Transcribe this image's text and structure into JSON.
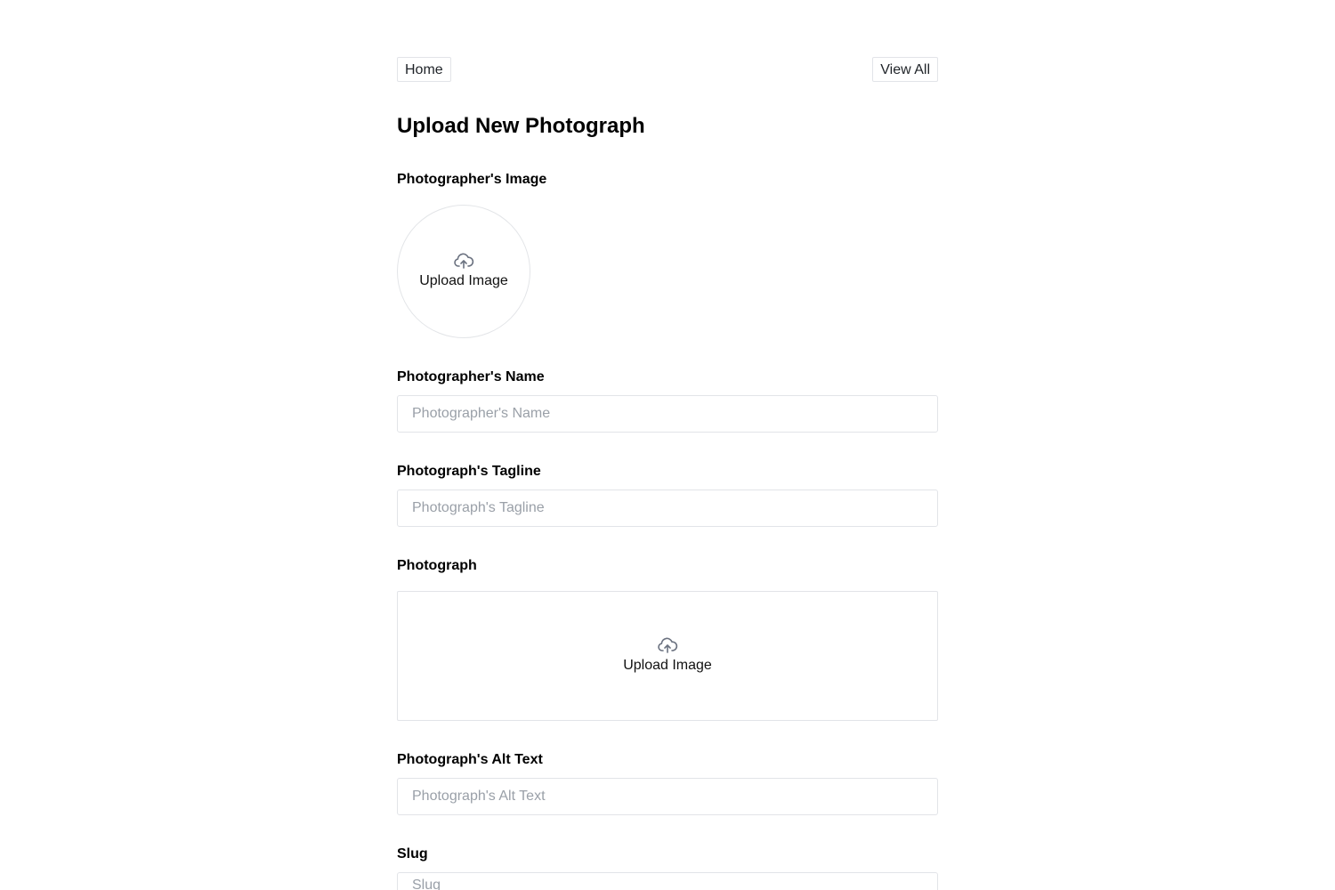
{
  "nav": {
    "home_label": "Home",
    "view_all_label": "View All"
  },
  "page": {
    "title": "Upload New Photograph"
  },
  "form": {
    "photographer_image": {
      "label": "Photographer's Image",
      "upload_text": "Upload Image",
      "icon": "cloud-upload-icon"
    },
    "photographer_name": {
      "label": "Photographer's Name",
      "placeholder": "Photographer's Name",
      "value": ""
    },
    "tagline": {
      "label": "Photograph's Tagline",
      "placeholder": "Photograph's Tagline",
      "value": ""
    },
    "photograph": {
      "label": "Photograph",
      "upload_text": "Upload Image",
      "icon": "cloud-upload-icon"
    },
    "alt_text": {
      "label": "Photograph's Alt Text",
      "placeholder": "Photograph's Alt Text",
      "value": ""
    },
    "slug": {
      "label": "Slug",
      "placeholder": "Slug",
      "value": ""
    }
  },
  "colors": {
    "border": "#e2e4e8",
    "placeholder": "#9aa0a8",
    "icon": "#6b7280",
    "text": "#111111"
  }
}
